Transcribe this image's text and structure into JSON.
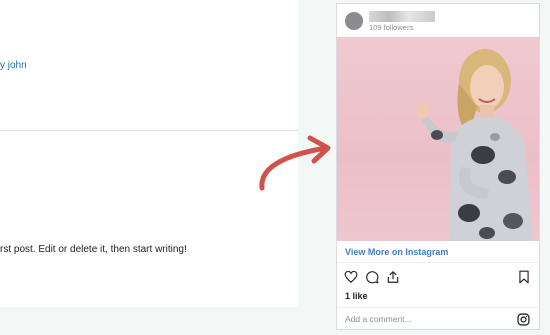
{
  "editor": {
    "byline": "y john",
    "excerpt": "rst post. Edit or delete it, then start writing!"
  },
  "instagram": {
    "followers": "109 followers",
    "view_more": "View More on Instagram",
    "likes": "1 like",
    "comment_placeholder": "Add a comment...",
    "icons": [
      "heart-icon",
      "comment-icon",
      "share-icon",
      "bookmark-icon",
      "instagram-logo-icon"
    ]
  },
  "colors": {
    "link": "#2271b1",
    "arrow": "#d1524a",
    "photo_bg": "#ecbfc8"
  }
}
